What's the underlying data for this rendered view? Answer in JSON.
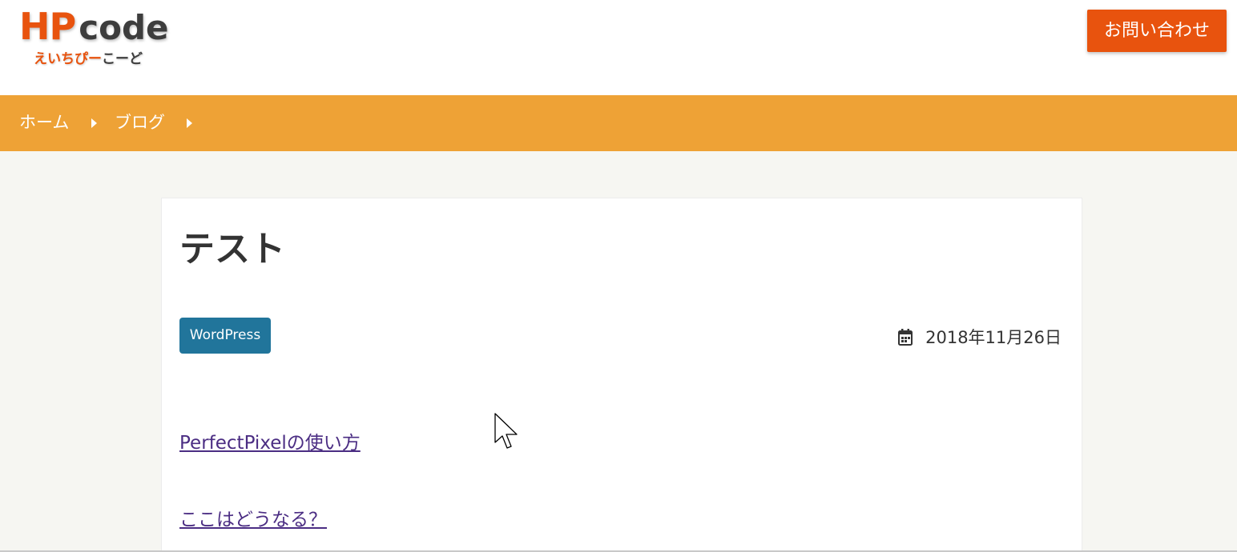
{
  "header": {
    "logo": {
      "main_1": "HP",
      "main_2": "code",
      "sub_1": "えいちぴー",
      "sub_2": "こーど"
    },
    "contact_label": "お問い合わせ"
  },
  "breadcrumb": {
    "items": [
      {
        "label": "ホーム"
      },
      {
        "label": "ブログ"
      }
    ]
  },
  "article": {
    "title": "テスト",
    "category": "WordPress",
    "date": "2018年11月26日",
    "links": [
      {
        "label": "PerfectPixelの使い方"
      },
      {
        "label": "ここはどうなる？"
      }
    ]
  },
  "colors": {
    "brand_orange": "#e8530e",
    "breadcrumb_bg": "#eea236",
    "tag_bg": "#21759b",
    "link": "#4b2d83"
  },
  "icons": [
    "calendar-icon",
    "chevron-right-icon",
    "mouse-pointer-icon"
  ]
}
